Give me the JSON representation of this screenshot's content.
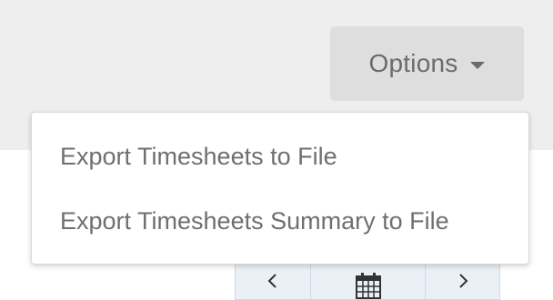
{
  "header": {
    "options_label": "Options",
    "caret_icon": "caret-down-icon"
  },
  "menu": {
    "items": [
      {
        "label": "Export Timesheets to File"
      },
      {
        "label": "Export Timesheets Summary to File"
      }
    ]
  },
  "date_nav": {
    "prev_icon": "chevron-left-icon",
    "calendar_icon": "calendar-icon",
    "next_icon": "chevron-right-icon"
  },
  "colors": {
    "band": "#eeeeee",
    "button": "#dedede",
    "text": "#6b6b6b"
  }
}
